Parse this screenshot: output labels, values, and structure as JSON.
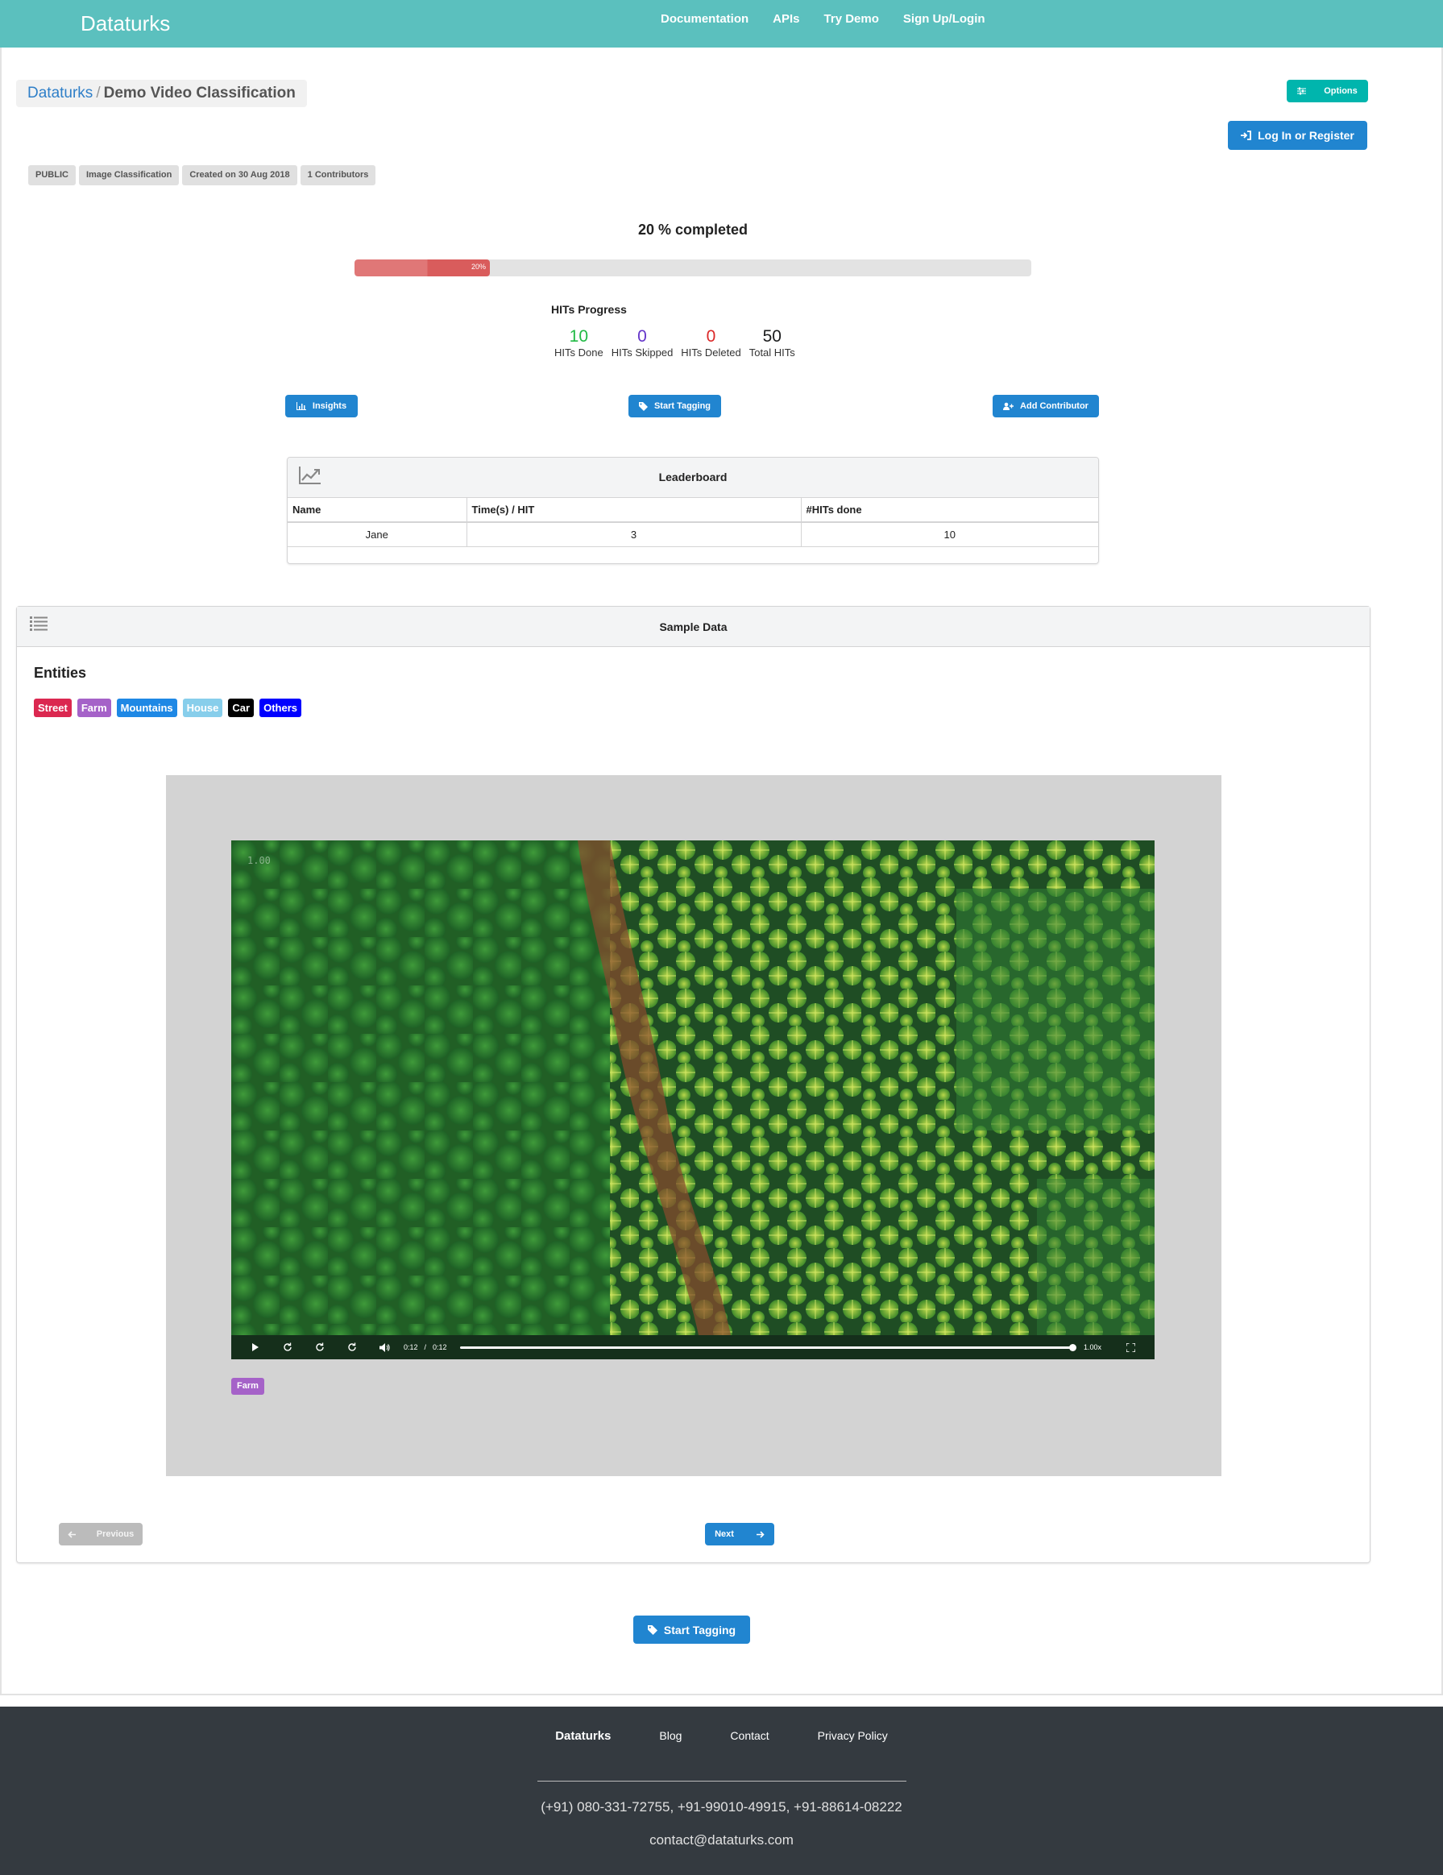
{
  "header": {
    "brand": "Dataturks",
    "nav": [
      "Documentation",
      "APIs",
      "Try Demo",
      "Sign Up/Login"
    ]
  },
  "breadcrumb": {
    "root": "Dataturks",
    "separator": "/",
    "current": "Demo Video Classification"
  },
  "buttons": {
    "options": "Options",
    "login": "Log In or Register",
    "insights": "Insights",
    "start_tagging": "Start Tagging",
    "add_contributor": "Add Contributor",
    "previous": "Previous",
    "next": "Next"
  },
  "project_labels": [
    "PUBLIC",
    "Image Classification",
    "Created on 30 Aug 2018",
    "1 Contributors"
  ],
  "progress": {
    "percent": 20,
    "completed_text": "20 % completed",
    "bar_label": "20%"
  },
  "hits": {
    "title": "HITs Progress",
    "stats": [
      {
        "value": "10",
        "label": "HITs Done",
        "color": "#21ba45"
      },
      {
        "value": "0",
        "label": "HITs Skipped",
        "color": "#6435c9"
      },
      {
        "value": "0",
        "label": "HITs Deleted",
        "color": "#db2828"
      },
      {
        "value": "50",
        "label": "Total HITs",
        "color": "#1b1c1d"
      }
    ]
  },
  "leaderboard": {
    "title": "Leaderboard",
    "columns": [
      "Name",
      "Time(s) / HIT",
      "#HITs done"
    ],
    "rows": [
      [
        "Jane",
        "3",
        "10"
      ]
    ]
  },
  "sample": {
    "title": "Sample Data",
    "entities_title": "Entities",
    "entities": [
      {
        "label": "Street",
        "color": "#db2850"
      },
      {
        "label": "Farm",
        "color": "#a562c8"
      },
      {
        "label": "Mountains",
        "color": "#1e88e5"
      },
      {
        "label": "House",
        "color": "#87ceeb"
      },
      {
        "label": "Car",
        "color": "#000000"
      },
      {
        "label": "Others",
        "color": "#0000ff"
      }
    ],
    "video": {
      "speed_overlay": "1.00",
      "current_time": "0:12",
      "time_sep": "/",
      "duration": "0:12",
      "playback_rate": "1.00x"
    },
    "assigned_tag": "Farm"
  },
  "footer": {
    "brand": "Dataturks",
    "links": [
      "Blog",
      "Contact",
      "Privacy Policy"
    ],
    "phone": "(+91) 080-331-72755, +91-99010-49915, +91-88614-08222",
    "email": "contact@dataturks.com"
  }
}
